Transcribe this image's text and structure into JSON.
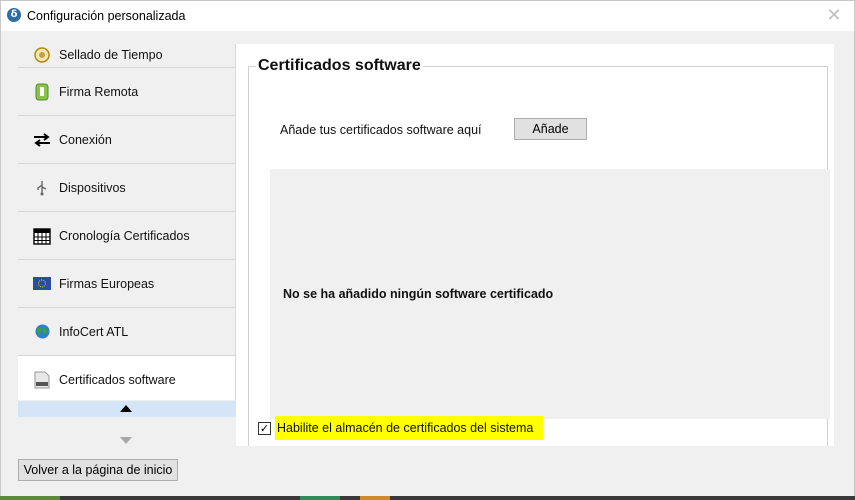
{
  "window": {
    "title": "Configuración personalizada",
    "app_icon": "δ",
    "close_glyph": "✕"
  },
  "sidebar": {
    "items": [
      {
        "label": "Sellado de Tiempo",
        "icon": "timestamp-seal-icon"
      },
      {
        "label": "Firma Remota",
        "icon": "remote-signature-icon"
      },
      {
        "label": "Conexión",
        "icon": "connection-arrows-icon"
      },
      {
        "label": "Dispositivos",
        "icon": "usb-icon"
      },
      {
        "label": "Cronología Certificados",
        "icon": "calendar-icon"
      },
      {
        "label": "Firmas Europeas",
        "icon": "eu-flag-icon"
      },
      {
        "label": "InfoCert ATL",
        "icon": "globe-icon"
      },
      {
        "label": "Certificados software",
        "icon": "pkcs12-file-icon"
      }
    ],
    "active_index": 7,
    "home_button": "Volver a la página de inicio"
  },
  "main": {
    "section_title": "Certificados software",
    "add_label": "Añade tus certificados software aquí",
    "add_button": "Añade",
    "empty_message": "No se ha añadido ningún software certificado",
    "system_store_checkbox": {
      "label": "Habilite el almacén de certificados del sistema",
      "checked": true,
      "check_glyph": "✓"
    }
  },
  "colors": {
    "highlight": "#ffff00",
    "scroll_up_bg": "#d3e5f6",
    "button_bg": "#e1e1e1"
  }
}
